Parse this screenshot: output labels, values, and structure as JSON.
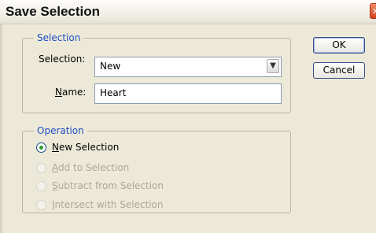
{
  "window": {
    "title": "Save Selection"
  },
  "selection_group": {
    "legend": "Selection",
    "selection_label": "Selection:",
    "selection_value": "New",
    "name_label_first": "N",
    "name_label_rest": "ame:",
    "name_value": "Heart"
  },
  "buttons": {
    "ok": "OK",
    "cancel": "Cancel"
  },
  "operation_group": {
    "legend": "Operation",
    "options": [
      {
        "first": "N",
        "rest": "ew Selection",
        "selected": true,
        "enabled": true
      },
      {
        "first": "A",
        "rest": "dd to Selection",
        "selected": false,
        "enabled": false
      },
      {
        "first": "S",
        "rest": "ubtract from Selection",
        "selected": false,
        "enabled": false
      },
      {
        "first": "I",
        "rest": "ntersect with Selection",
        "selected": false,
        "enabled": false
      }
    ]
  },
  "colors": {
    "accent": "#1f4ec3",
    "dialog_bg": "#ece9d8",
    "radio_dot": "#2d9b2d"
  }
}
